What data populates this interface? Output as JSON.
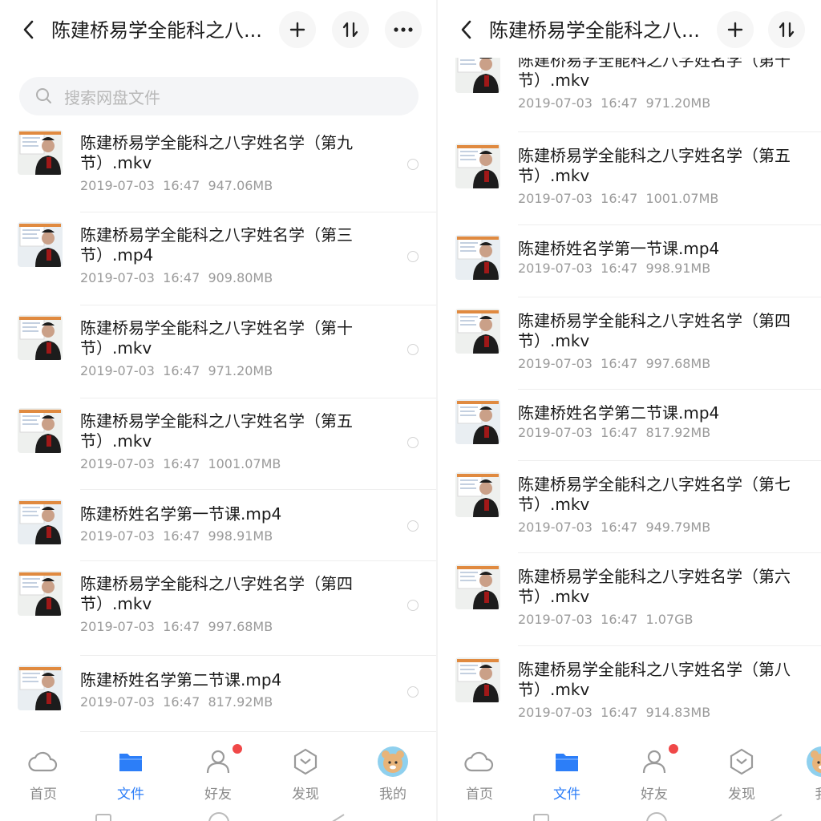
{
  "left": {
    "header": {
      "title": "陈建桥易学全能科之八..."
    },
    "search": {
      "placeholder": "搜索网盘文件"
    },
    "files": [
      {
        "name": "陈建桥易学全能科之八字姓名学（第九节）.mkv",
        "date": "2019-07-03",
        "time": "16:47",
        "size": "947.06MB"
      },
      {
        "name": "陈建桥易学全能科之八字姓名学（第三节）.mp4",
        "date": "2019-07-03",
        "time": "16:47",
        "size": "909.80MB"
      },
      {
        "name": "陈建桥易学全能科之八字姓名学（第十节）.mkv",
        "date": "2019-07-03",
        "time": "16:47",
        "size": "971.20MB"
      },
      {
        "name": "陈建桥易学全能科之八字姓名学（第五节）.mkv",
        "date": "2019-07-03",
        "time": "16:47",
        "size": "1001.07MB"
      },
      {
        "name": "陈建桥姓名学第一节课.mp4",
        "date": "2019-07-03",
        "time": "16:47",
        "size": "998.91MB"
      },
      {
        "name": "陈建桥易学全能科之八字姓名学（第四节）.mkv",
        "date": "2019-07-03",
        "time": "16:47",
        "size": "997.68MB"
      },
      {
        "name": "陈建桥姓名学第二节课.mp4",
        "date": "2019-07-03",
        "time": "16:47",
        "size": "817.92MB"
      }
    ]
  },
  "right": {
    "header": {
      "title": "陈建桥易学全能科之八..."
    },
    "files": [
      {
        "name": "陈建桥易学全能科之八字姓名学（第十节）.mkv",
        "date": "2019-07-03",
        "time": "16:47",
        "size": "971.20MB"
      },
      {
        "name": "陈建桥易学全能科之八字姓名学（第五节）.mkv",
        "date": "2019-07-03",
        "time": "16:47",
        "size": "1001.07MB"
      },
      {
        "name": "陈建桥姓名学第一节课.mp4",
        "date": "2019-07-03",
        "time": "16:47",
        "size": "998.91MB"
      },
      {
        "name": "陈建桥易学全能科之八字姓名学（第四节）.mkv",
        "date": "2019-07-03",
        "time": "16:47",
        "size": "997.68MB"
      },
      {
        "name": "陈建桥姓名学第二节课.mp4",
        "date": "2019-07-03",
        "time": "16:47",
        "size": "817.92MB"
      },
      {
        "name": "陈建桥易学全能科之八字姓名学（第七节）.mkv",
        "date": "2019-07-03",
        "time": "16:47",
        "size": "949.79MB"
      },
      {
        "name": "陈建桥易学全能科之八字姓名学（第六节）.mkv",
        "date": "2019-07-03",
        "time": "16:47",
        "size": "1.07GB"
      },
      {
        "name": "陈建桥易学全能科之八字姓名学（第八节）.mkv",
        "date": "2019-07-03",
        "time": "16:47",
        "size": "914.83MB"
      }
    ]
  },
  "tabbar": {
    "tabs": [
      {
        "label": "首页",
        "icon": "cloud-icon"
      },
      {
        "label": "文件",
        "icon": "folder-icon",
        "active": true
      },
      {
        "label": "好友",
        "icon": "friends-icon",
        "badge": true
      },
      {
        "label": "发现",
        "icon": "discover-icon"
      },
      {
        "label": "我的",
        "icon": "avatar-icon"
      }
    ],
    "right_partial_label": "我"
  },
  "colors": {
    "accent": "#2c7ef8",
    "badge": "#f04848",
    "meta": "#9a9a9a"
  }
}
